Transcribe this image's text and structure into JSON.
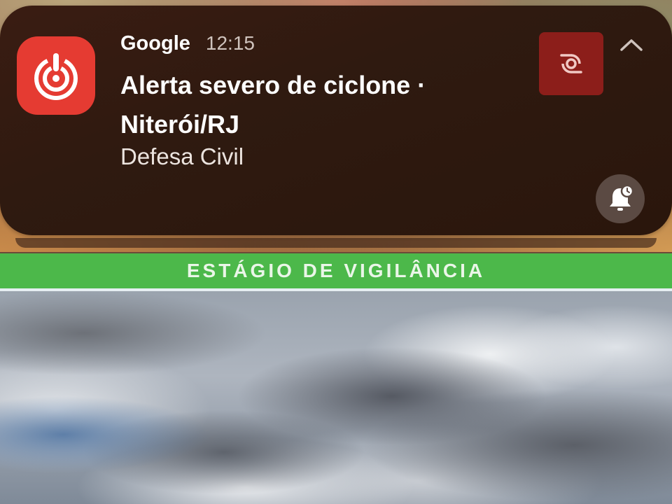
{
  "notification": {
    "app_name": "Google",
    "time": "12:15",
    "title": "Alerta severo de ciclone · Niterói/RJ",
    "subtitle": "Defesa Civil",
    "app_icon": "emergency-alert-icon",
    "thumbnail_icon": "cyclone-icon",
    "collapse_icon": "chevron-up-icon",
    "action_icon": "bell-snooze-icon",
    "colors": {
      "app_icon_bg": "#e53b32",
      "thumbnail_bg": "#8c1e1a",
      "card_bg": "#2f1a10"
    }
  },
  "banner": {
    "label": "ESTÁGIO DE VIGILÂNCIA",
    "color": "#4cb84a"
  },
  "background": {
    "scene": "cloudy-sky-photo"
  }
}
